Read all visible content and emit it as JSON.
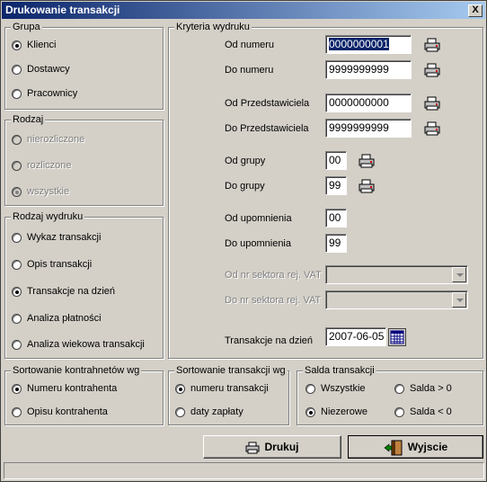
{
  "window": {
    "title": "Drukowanie transakcji",
    "close_label": "X"
  },
  "grupa": {
    "legend": "Grupa",
    "options": [
      {
        "label": "Klienci",
        "selected": true
      },
      {
        "label": "Dostawcy",
        "selected": false
      },
      {
        "label": "Pracownicy",
        "selected": false
      }
    ]
  },
  "rodzaj": {
    "legend": "Rodzaj",
    "options": [
      {
        "label": "nierozliczone",
        "selected": false
      },
      {
        "label": "rozliczone",
        "selected": false
      },
      {
        "label": "wszystkie",
        "selected": true
      }
    ]
  },
  "rodzaj_wydruku": {
    "legend": "Rodzaj wydruku",
    "options": [
      {
        "label": "Wykaz transakcji",
        "selected": false
      },
      {
        "label": "Opis transakcji",
        "selected": false
      },
      {
        "label": "Transakcje na dzień",
        "selected": true
      },
      {
        "label": "Analiza płatności",
        "selected": false
      },
      {
        "label": "Analiza wiekowa transakcji",
        "selected": false
      }
    ]
  },
  "kryteria": {
    "legend": "Kryteria wydruku",
    "od_numeru": {
      "label": "Od numeru",
      "value": "0000000001"
    },
    "do_numeru": {
      "label": "Do numeru",
      "value": "9999999999"
    },
    "od_przedstawiciela": {
      "label": "Od Przedstawiciela",
      "value": "0000000000"
    },
    "do_przedstawiciela": {
      "label": "Do Przedstawiciela",
      "value": "9999999999"
    },
    "od_grupy": {
      "label": "Od grupy",
      "value": "00"
    },
    "do_grupy": {
      "label": "Do grupy",
      "value": "99"
    },
    "od_upomnienia": {
      "label": "Od upomnienia",
      "value": "00"
    },
    "do_upomnienia": {
      "label": "Do upomnienia",
      "value": "99"
    },
    "od_sektora": {
      "label": "Od nr sektora rej. VAT",
      "value": ""
    },
    "do_sektora": {
      "label": "Do nr sektora rej. VAT",
      "value": ""
    },
    "transakcje_na_dzien": {
      "label": "Transakcje na dzień",
      "value": "2007-06-05"
    }
  },
  "sort_kontrahentow": {
    "legend": "Sortowanie kontrahnetów wg",
    "options": [
      {
        "label": "Numeru kontrahenta",
        "selected": true
      },
      {
        "label": "Opisu kontrahenta",
        "selected": false
      }
    ]
  },
  "sort_transakcji": {
    "legend": "Sortowanie transakcji wg",
    "options": [
      {
        "label": "numeru transakcji",
        "selected": true
      },
      {
        "label": "daty zapłaty",
        "selected": false
      }
    ]
  },
  "salda": {
    "legend": "Salda transakcji",
    "options": [
      {
        "label": "Wszystkie",
        "selected": false
      },
      {
        "label": "Salda > 0",
        "selected": false
      },
      {
        "label": "Niezerowe",
        "selected": true
      },
      {
        "label": "Salda < 0",
        "selected": false
      }
    ]
  },
  "buttons": {
    "drukuj": "Drukuj",
    "wyjscie": "Wyjscie"
  },
  "status": {
    "text": ""
  },
  "icons": {
    "print": "printer-icon",
    "calendar": "calendar-icon",
    "exit": "exit-door-icon"
  }
}
